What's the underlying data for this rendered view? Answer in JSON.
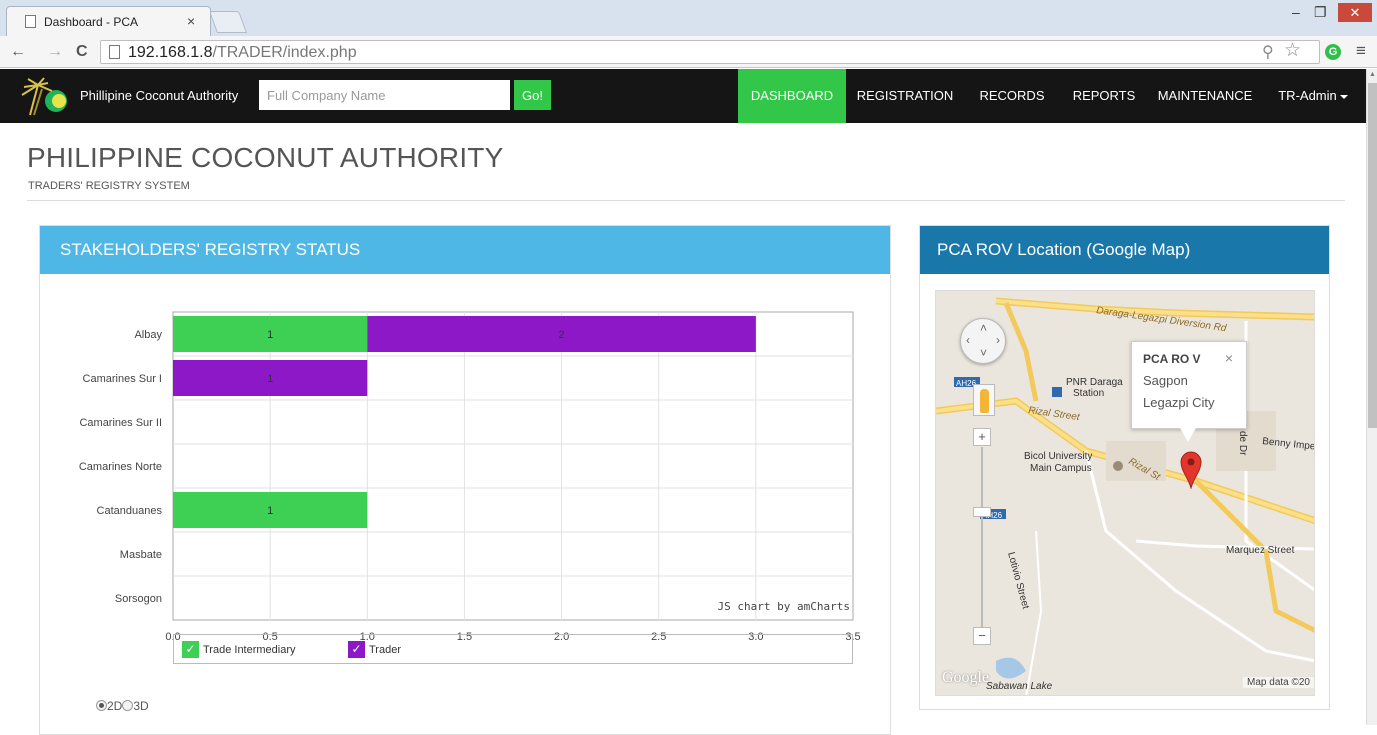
{
  "browser": {
    "tab_title": "Dashboard - PCA",
    "tab_close": "×",
    "url_host": "192.168.1.8",
    "url_path": "/TRADER/index.php",
    "back": "←",
    "forward": "→",
    "reload": "C",
    "minimize": "–",
    "restore": "❐",
    "close": "✕",
    "key_icon": "⚲",
    "star_icon": "☆",
    "ext_icon": "G",
    "menu_icon": "≡"
  },
  "navbar": {
    "brand": "Phillipine Coconut Authority",
    "search_placeholder": "Full Company Name",
    "go_label": "Go!",
    "items": [
      {
        "label": "DASHBOARD",
        "active": true
      },
      {
        "label": "REGISTRATION",
        "active": false
      },
      {
        "label": "RECORDS",
        "active": false
      },
      {
        "label": "REPORTS",
        "active": false
      },
      {
        "label": "MAINTENANCE",
        "active": false
      }
    ],
    "user": "TR-Admin"
  },
  "header": {
    "title": "PHILIPPINE COCONUT AUTHORITY",
    "subtitle": "TRADERS' REGISTRY SYSTEM"
  },
  "left_panel": {
    "title": "STAKEHOLDERS' REGISTRY STATUS",
    "view_2d": "2D",
    "view_3d": "3D",
    "view_selected": "2D"
  },
  "chart_data": {
    "type": "bar",
    "orientation": "horizontal",
    "stacked": true,
    "categories": [
      "Albay",
      "Camarines Sur I",
      "Camarines Sur II",
      "Camarines Norte",
      "Catanduanes",
      "Masbate",
      "Sorsogon"
    ],
    "series": [
      {
        "name": "Trade Intermediary",
        "color": "#3ecf55",
        "values": [
          1,
          0,
          0,
          0,
          1,
          0,
          0
        ]
      },
      {
        "name": "Trader",
        "color": "#8d18c8",
        "values": [
          2,
          1,
          0,
          0,
          0,
          0,
          0
        ]
      }
    ],
    "xlim": [
      0,
      3.5
    ],
    "xticks": [
      "0.0",
      "0.5",
      "1.0",
      "1.5",
      "2.0",
      "2.5",
      "3.0",
      "3.5"
    ],
    "credit": "JS chart by amCharts",
    "grid": true,
    "legend_position": "bottom"
  },
  "right_panel": {
    "title": "PCA ROV Location (Google Map)",
    "info_title": "PCA RO V",
    "info_line1": "Sagpon",
    "info_line2": "Legazpi City",
    "info_close": "×",
    "google": "Google",
    "attribution": "Map data ©20",
    "labels": {
      "road1": "Daraga-Legazpi Diversion Rd",
      "station": "PNR Daraga",
      "station2": "Station",
      "rizal1": "Rizal Street",
      "rizal2": "Rizal St",
      "university": "Bicol University",
      "university2": "Main Campus",
      "benny": "Benny Imper",
      "marquez": "Marquez Street",
      "lotivio": "Lotivio Street",
      "sabawan": "Sabawan Lake",
      "ah26a": "AH26",
      "ah26b": "AH26",
      "de_dr": "de Dr"
    }
  }
}
